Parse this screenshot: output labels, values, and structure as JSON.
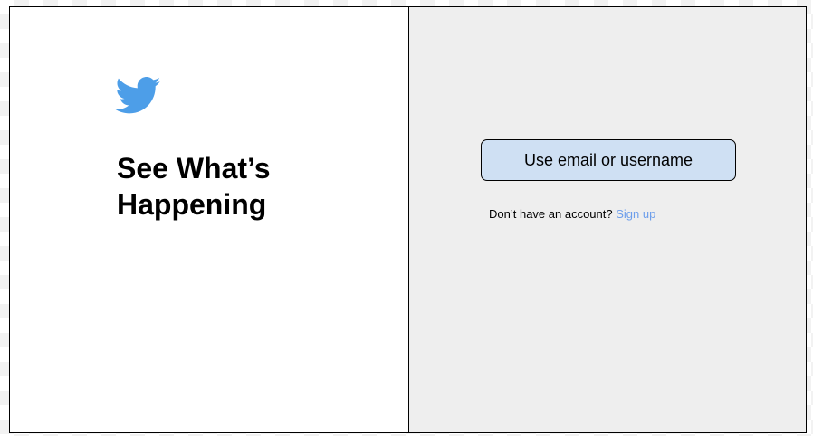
{
  "brand": {
    "logo_icon": "twitter-bird-icon",
    "logo_color": "#4d9ee8"
  },
  "hero": {
    "headline": "See What’s Happening"
  },
  "login": {
    "email_button_label": "Use email or username",
    "button_bg": "#cfe0f3"
  },
  "signup": {
    "prompt": "Don’t have an account?",
    "link_label": "Sign up",
    "link_color": "#6d9eeb"
  },
  "colors": {
    "left_panel_bg": "#ffffff",
    "right_panel_bg": "#eeeeee",
    "border": "#000000"
  }
}
